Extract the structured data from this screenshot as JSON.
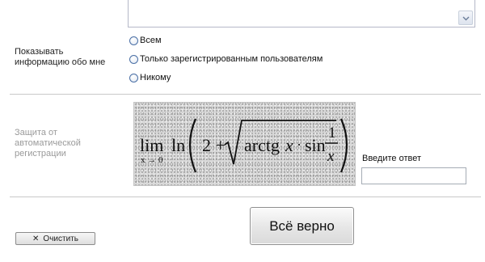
{
  "privacy": {
    "label_line1": "Показывать",
    "label_line2": "информацию обо мне",
    "options": [
      "Всем",
      "Только зарегистрированным пользователям",
      "Никому"
    ]
  },
  "captcha": {
    "label_line1": "Защита от",
    "label_line2": "автоматической",
    "label_line3": "регистрации",
    "expression": {
      "lim": "lim",
      "lim_sub": "x → 0",
      "ln": "ln",
      "two_plus": "2 +",
      "arctg": "arctg",
      "x": "x",
      "dot": "·",
      "sin": "sin",
      "num": "1",
      "den": "x"
    },
    "answer_label": "Введите ответ",
    "answer_value": ""
  },
  "buttons": {
    "submit_label": "Всё верно",
    "clear_icon": "✕",
    "clear_label": "Очистить"
  },
  "icons": {
    "scroll": "chevron-down-icon"
  },
  "colors": {
    "radio_border": "#4a6fa5",
    "dim_label": "#9a9a9a",
    "divider": "#c9c9c9"
  }
}
